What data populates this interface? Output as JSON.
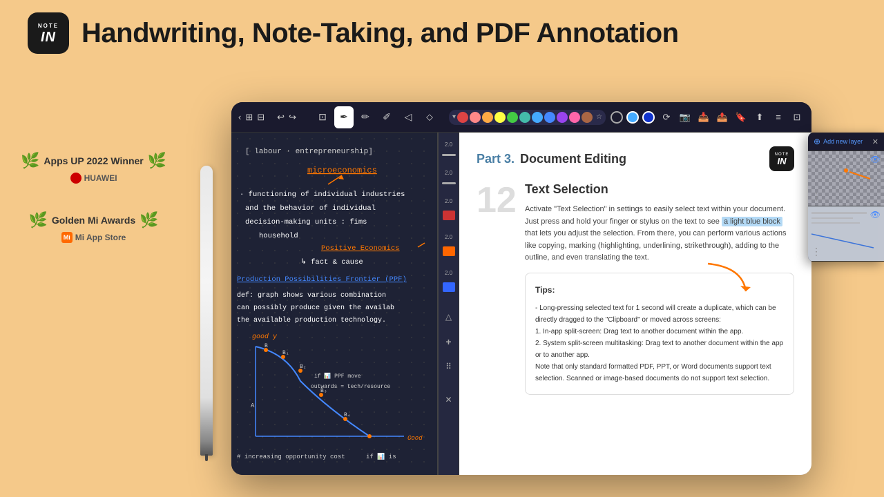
{
  "header": {
    "logo_note": "NOTE",
    "logo_in": "IN",
    "title": "Handwriting, Note-Taking, and PDF Annotation"
  },
  "awards": [
    {
      "id": "apps-up",
      "title": "Apps UP 2022 Winner",
      "brand": "HUAWEI"
    },
    {
      "id": "golden-mi",
      "title": "Golden Mi Awards",
      "brand": "Mi App Store"
    }
  ],
  "tablet": {
    "toolbar": {
      "icons": [
        "‹",
        "⊞",
        "⊟",
        "↩",
        "↪"
      ],
      "pen_tools": [
        "✒",
        "✏",
        "✐",
        "▲",
        "▼"
      ],
      "colors": [
        "#e87070",
        "#ff9999",
        "#ffbb44",
        "#ffee44",
        "#88dd44",
        "#44ccaa",
        "#44aaff",
        "#4488ff",
        "#8866ff",
        "#ff66aa",
        "#cc6633"
      ],
      "right_icons": [
        "⟳",
        "📷",
        "📥",
        "📤",
        "📋",
        "📤",
        "⬇",
        "≡",
        "⊡"
      ]
    },
    "handwriting": {
      "lines": [
        "[ labour · entrepreneurship]",
        "",
        "         microeconomics",
        "",
        "· functioning of individual industries",
        "  and the behavior of individual",
        "  decision-making units : fims",
        "            household",
        "                    Positive Economics",
        "               ↳ fact & cause",
        "",
        "Production Possibilities Frontier (PPF)",
        "",
        "def: graph shows various combination",
        "can possibly produce given the availab",
        "the available production technology.",
        "",
        "         good y",
        "",
        "",
        "",
        "",
        "",
        "                              Good",
        "# increasing opportunity cost"
      ]
    },
    "pdf": {
      "part_label": "Part 3.",
      "part_title": "Document Editing",
      "section_number": "12",
      "section_title": "Text Selection",
      "description": "Activate \"Text Selection\" in settings to easily select text within your document. Just press and hold your finger or stylus on the text to see a light blue block that lets you adjust the selection. From there, you can perform various actions like copying, marking (highlighting, underlining, strikethrough), adding to the outline, and even translating the text.",
      "highlight_text": "a light blue block",
      "tips": {
        "title": "Tips:",
        "items": [
          "- Long-pressing selected text for 1 second will create a duplicate, which can be directly dragged to the \"Clipboard\" or moved across screens:",
          "1. In-app split-screen: Drag text to another document within the app.",
          "2. System split-screen multitasking: Drag text to another document within the app or to another app.",
          "Note that only standard formatted PDF, PPT, or Word documents support text selection. Scanned or image-based documents do not support text selection."
        ]
      }
    },
    "layers": {
      "add_label": "Add new layer",
      "close_icon": "✕"
    }
  }
}
